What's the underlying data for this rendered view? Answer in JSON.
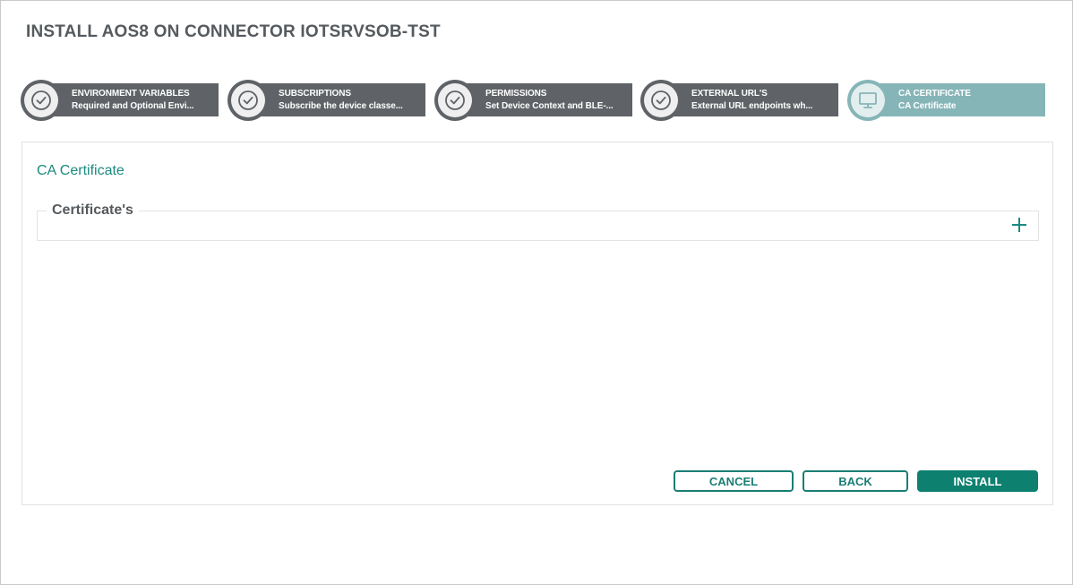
{
  "dialog": {
    "title": "INSTALL AOS8 ON CONNECTOR IOTSRVSOB-TST"
  },
  "steps": [
    {
      "title": "ENVIRONMENT VARIABLES",
      "subtitle": "Required and Optional Envi...",
      "icon": "check-icon",
      "state": "complete"
    },
    {
      "title": "SUBSCRIPTIONS",
      "subtitle": "Subscribe the device classe...",
      "icon": "check-icon",
      "state": "complete"
    },
    {
      "title": "PERMISSIONS",
      "subtitle": "Set Device Context and BLE-...",
      "icon": "check-icon",
      "state": "complete"
    },
    {
      "title": "EXTERNAL URL'S",
      "subtitle": "External URL endpoints wh...",
      "icon": "check-icon",
      "state": "complete"
    },
    {
      "title": "CA CERTIFICATE",
      "subtitle": "CA Certificate",
      "icon": "monitor-icon",
      "state": "active"
    }
  ],
  "content": {
    "section_title": "CA Certificate",
    "fieldset_legend": "Certificate's",
    "add_icon": "plus-icon"
  },
  "buttons": {
    "cancel": "CANCEL",
    "back": "BACK",
    "install": "INSTALL"
  },
  "colors": {
    "accent": "#1b8a7f",
    "step_complete": "#5f6367",
    "step_active": "#86b5b8",
    "primary_button": "#0e8070"
  }
}
